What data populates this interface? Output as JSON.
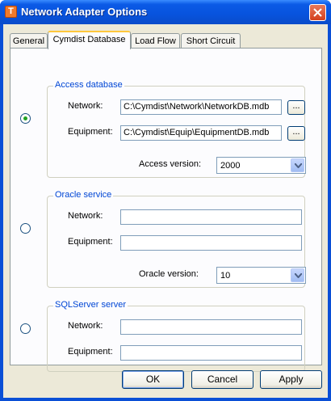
{
  "window": {
    "title": "Network Adapter Options",
    "app_icon_letter": "T"
  },
  "tabs": [
    {
      "label": "General"
    },
    {
      "label": "Cymdist Database"
    },
    {
      "label": "Load Flow"
    },
    {
      "label": "Short Circuit"
    }
  ],
  "access": {
    "title": "Access database",
    "selected": true,
    "network_label": "Network:",
    "network_value": "C:\\Cymdist\\Network\\NetworkDB.mdb",
    "equipment_label": "Equipment:",
    "equipment_value": "C:\\Cymdist\\Equip\\EquipmentDB.mdb",
    "browse_label": "...",
    "version_label": "Access version:",
    "version_value": "2000"
  },
  "oracle": {
    "title": "Oracle service",
    "selected": false,
    "network_label": "Network:",
    "network_value": "",
    "equipment_label": "Equipment:",
    "equipment_value": "",
    "version_label": "Oracle version:",
    "version_value": "10"
  },
  "sqlserver": {
    "title": "SQLServer server",
    "selected": false,
    "network_label": "Network:",
    "network_value": "",
    "equipment_label": "Equipment:",
    "equipment_value": ""
  },
  "buttons": {
    "ok": "OK",
    "cancel": "Cancel",
    "apply": "Apply"
  },
  "colors": {
    "titlebar": "#0753dd",
    "face": "#ece9d8",
    "group_title": "#0046d5",
    "radio_dot": "#21a121"
  }
}
